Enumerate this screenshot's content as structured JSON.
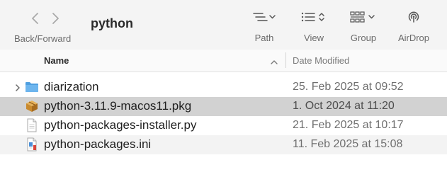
{
  "toolbar": {
    "nav_label": "Back/Forward",
    "folder_title": "python",
    "path_label": "Path",
    "view_label": "View",
    "group_label": "Group",
    "airdrop_label": "AirDrop"
  },
  "columns": {
    "name": "Name",
    "date_modified": "Date Modified",
    "sort": "ascending"
  },
  "files": [
    {
      "name": "diarization",
      "date": "25. Feb 2025 at 09:52",
      "kind": "folder",
      "icon": "folder-icon",
      "selected": false,
      "expandable": true
    },
    {
      "name": "python-3.11.9-macos11.pkg",
      "date": "1. Oct 2024 at 11:20",
      "kind": "package",
      "icon": "package-icon",
      "selected": true,
      "expandable": false
    },
    {
      "name": "python-packages-installer.py",
      "date": "21. Feb 2025 at 10:17",
      "kind": "python script",
      "icon": "document-icon",
      "selected": false,
      "expandable": false
    },
    {
      "name": "python-packages.ini",
      "date": "11. Feb 2025 at 15:08",
      "kind": "ini file",
      "icon": "ini-file-icon",
      "selected": false,
      "expandable": false
    }
  ],
  "colors": {
    "folder": "#5aa8e6",
    "selection": "#d2d2d2",
    "stripe": "#f3f3f3",
    "toolbar": "#f4f4f4"
  }
}
